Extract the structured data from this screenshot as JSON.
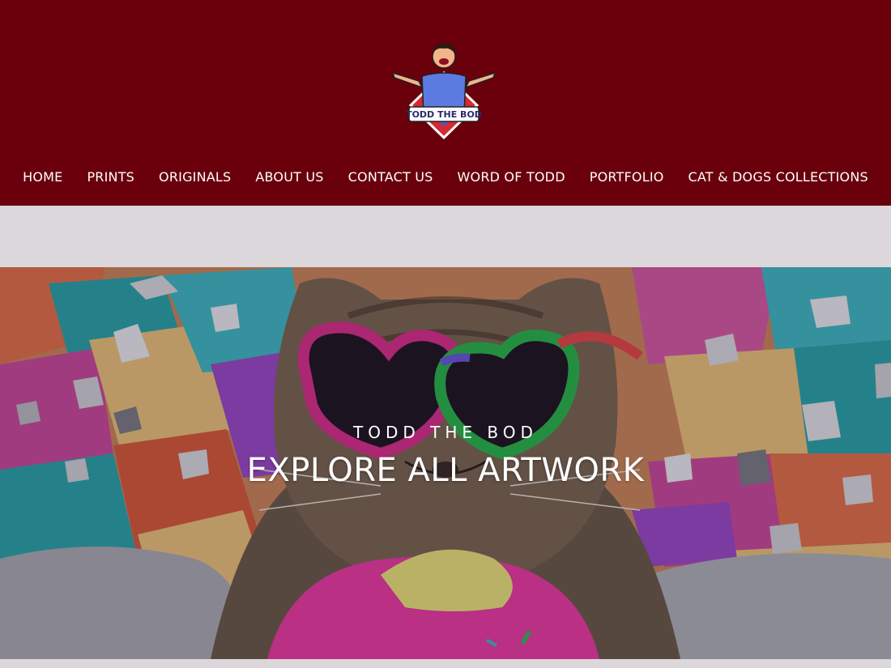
{
  "brand": {
    "logo_text": "TODD THE BOD",
    "colors": {
      "header_bg": "#69000c",
      "nav_text": "#ffffff",
      "page_bg": "#dcd7da"
    }
  },
  "nav": {
    "items": [
      {
        "label": "HOME"
      },
      {
        "label": "PRINTS"
      },
      {
        "label": "ORIGINALS"
      },
      {
        "label": "ABOUT US"
      },
      {
        "label": "CONTACT US"
      },
      {
        "label": "WORD OF TODD"
      },
      {
        "label": "PORTFOLIO"
      },
      {
        "label": "CAT & DOGS COLLECTIONS"
      }
    ]
  },
  "hero": {
    "kicker": "TODD THE BOD",
    "title": "EXPLORE ALL ARTWORK",
    "image_icon": "cat-heart-sunglasses-artwork"
  }
}
